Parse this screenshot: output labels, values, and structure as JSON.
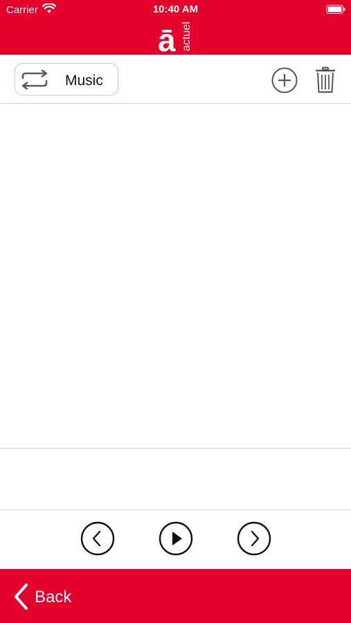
{
  "status_bar": {
    "carrier": "Carrier",
    "time": "10:40 AM"
  },
  "header": {
    "brand_letter": "ā",
    "brand_word": "actuel",
    "brand_color": "#E4002B"
  },
  "toolbar": {
    "mode_label": "Music",
    "mode_icon": "repeat-icon",
    "add_icon": "plus-circle-icon",
    "delete_icon": "trash-icon"
  },
  "player": {
    "previous_icon": "chevron-left-circle-icon",
    "play_icon": "play-circle-icon",
    "next_icon": "chevron-right-circle-icon"
  },
  "footer": {
    "back_label": "Back",
    "back_icon": "chevron-left-icon"
  }
}
